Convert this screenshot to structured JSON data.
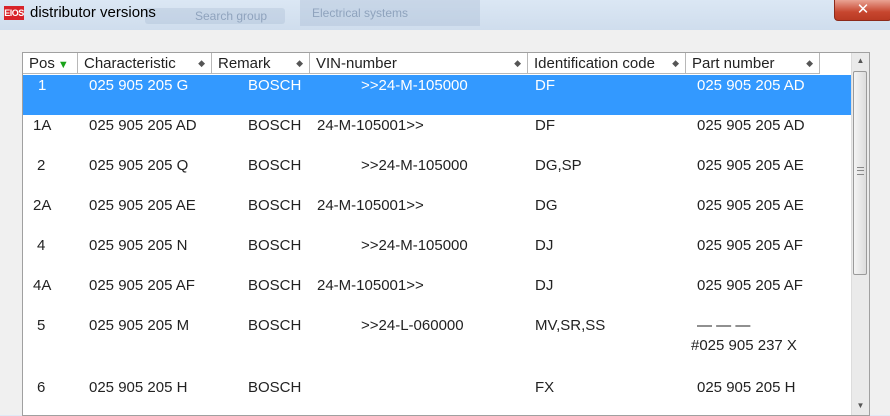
{
  "window": {
    "title": "distributor versions",
    "app_badge": "ElOS",
    "close_glyph": "✕",
    "background_tabs": [
      "Search group",
      "Electrical systems"
    ]
  },
  "table": {
    "columns": [
      {
        "label": "Pos",
        "sort": "▼"
      },
      {
        "label": "Characteristic",
        "marker": "◆"
      },
      {
        "label": "Remark",
        "marker": "◆"
      },
      {
        "label": "VIN-number",
        "marker": "◆"
      },
      {
        "label": "Identification code",
        "marker": "◆"
      },
      {
        "label": "Part number",
        "marker": "◆"
      }
    ],
    "rows": [
      {
        "pos": "1",
        "characteristic": "025 905 205 G",
        "remark": "BOSCH",
        "vin": ">>24-M-105000",
        "id_code": "DF",
        "part": "025 905 205 AD",
        "selected": true
      },
      {
        "pos": "1A",
        "characteristic": "025 905 205 AD",
        "remark": "BOSCH",
        "vin": "24-M-105001>>",
        "id_code": "DF",
        "part": "025 905 205 AD"
      },
      {
        "pos": "2",
        "characteristic": "025 905 205 Q",
        "remark": "BOSCH",
        "vin": ">>24-M-105000",
        "id_code": "DG,SP",
        "part": "025 905 205 AE"
      },
      {
        "pos": "2A",
        "characteristic": "025 905 205 AE",
        "remark": "BOSCH",
        "vin": "24-M-105001>>",
        "id_code": "DG",
        "part": "025 905 205 AE"
      },
      {
        "pos": "4",
        "characteristic": "025 905 205 N",
        "remark": "BOSCH",
        "vin": ">>24-M-105000",
        "id_code": "DJ",
        "part": "025 905 205 AF"
      },
      {
        "pos": "4A",
        "characteristic": "025 905 205 AF",
        "remark": "BOSCH",
        "vin": "24-M-105001>>",
        "id_code": "DJ",
        "part": "025 905 205 AF"
      },
      {
        "pos": "5",
        "characteristic": "025 905 205 M",
        "remark": "BOSCH",
        "vin": ">>24-L-060000",
        "id_code": "MV,SR,SS",
        "part": "— — —",
        "part_extra": "#025 905 237 X"
      },
      {
        "pos": "6",
        "characteristic": "025 905 205 H",
        "remark": "BOSCH",
        "vin": "",
        "id_code": "FX",
        "part": "025 905 205 H"
      }
    ]
  },
  "scrollbar": {
    "up_glyph": "▲",
    "down_glyph": "▼"
  }
}
